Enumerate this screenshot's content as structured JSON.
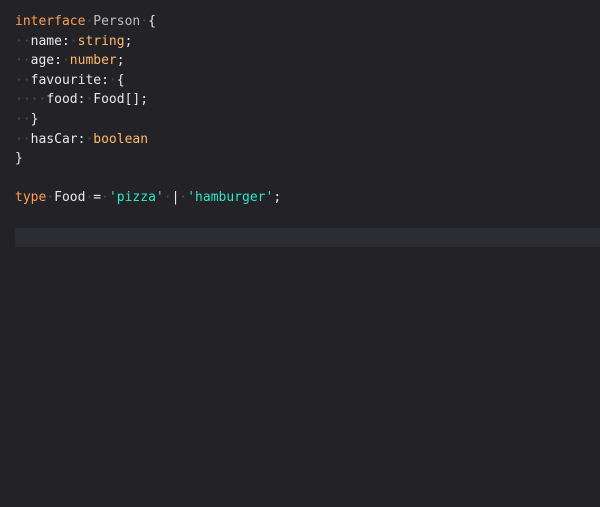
{
  "code": {
    "line1": {
      "kw": "interface",
      "name": "Person",
      "brace": "{"
    },
    "line2": {
      "prop": "name",
      "colon": ":",
      "type": "string",
      "semi": ";"
    },
    "line3": {
      "prop": "age",
      "colon": ":",
      "type": "number",
      "semi": ";"
    },
    "line4": {
      "prop": "favourite",
      "colon": ":",
      "brace": "{"
    },
    "line5": {
      "prop": "food",
      "colon": ":",
      "type": "Food[]",
      "semi": ";"
    },
    "line6": {
      "brace": "}"
    },
    "line7": {
      "prop": "hasCar",
      "colon": ":",
      "type": "boolean"
    },
    "line8": {
      "brace": "}"
    },
    "line10": {
      "kw": "type",
      "name": "Food",
      "eq": "=",
      "str1": "'pizza'",
      "pipe": "|",
      "str2": "'hamburger'",
      "semi": ";"
    }
  },
  "colors": {
    "background": "#232327",
    "keyword": "#ff9d52",
    "string": "#2ee6c9",
    "active_line": "#2b2d33"
  }
}
